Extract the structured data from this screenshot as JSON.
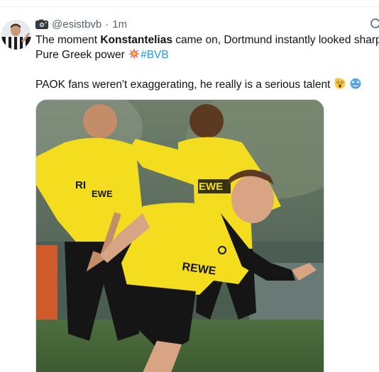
{
  "tweet": {
    "handle": "@esistbvb",
    "separator": "·",
    "time": "1m",
    "line1_before": "The moment ",
    "line1_bold": "Konstantelias",
    "line1_after": "  came on, Dortmund instantly looked sharp",
    "line2_text": "Pure Greek power ",
    "line2_hashtag": "#BVB",
    "line3_text": "PAOK fans weren't exaggerating, he really is a serious talent "
  },
  "photo": {
    "shirt_sponsor_left": "RI",
    "shirt_sponsor_left2": "EWE",
    "shirt_sponsor_back": "EWE",
    "shirt_sponsor_front": "REWE"
  },
  "icons": {
    "camera": "camera-icon",
    "collision": "collision-emoji",
    "astonished": "astonished-emoji",
    "cold_face": "cold-face-emoji",
    "grok": "grok-icon"
  },
  "colors": {
    "text": "#0f1419",
    "secondary": "#536471",
    "link": "#1d9bf0",
    "bvb_yellow": "#f7e11b"
  }
}
